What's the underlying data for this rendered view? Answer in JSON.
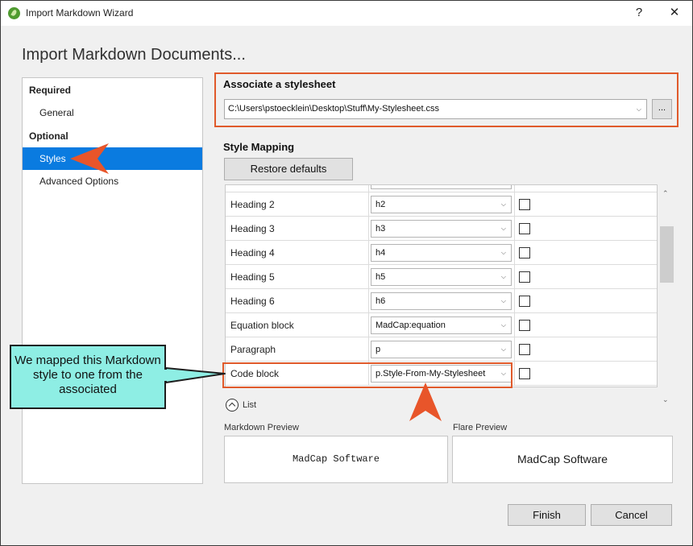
{
  "window": {
    "title": "Import Markdown Wizard",
    "help": "?",
    "close": "✕"
  },
  "heading": "Import Markdown Documents...",
  "nav": {
    "required": "Required",
    "general": "General",
    "optional": "Optional",
    "styles": "Styles",
    "advanced": "Advanced Options"
  },
  "stylesheet": {
    "label": "Associate a stylesheet",
    "path": "C:\\Users\\pstoecklein\\Desktop\\Stuff\\My-Stylesheet.css",
    "browse": "..."
  },
  "mapping": {
    "label": "Style Mapping",
    "restore": "Restore defaults",
    "rows": [
      {
        "name": "Heading 2",
        "style": "h2"
      },
      {
        "name": "Heading 3",
        "style": "h3"
      },
      {
        "name": "Heading 4",
        "style": "h4"
      },
      {
        "name": "Heading 5",
        "style": "h5"
      },
      {
        "name": "Heading 6",
        "style": "h6"
      },
      {
        "name": "Equation block",
        "style": "MadCap:equation"
      },
      {
        "name": "Paragraph",
        "style": "p"
      },
      {
        "name": "Code block",
        "style": "p.Style-From-My-Stylesheet"
      }
    ],
    "list_label": "List"
  },
  "preview": {
    "markdown_label": "Markdown Preview",
    "markdown_text": "MadCap Software",
    "flare_label": "Flare Preview",
    "flare_text": "MadCap Software"
  },
  "buttons": {
    "finish": "Finish",
    "cancel": "Cancel"
  },
  "callout": "We mapped this Markdown style to one from the associated",
  "colors": {
    "highlight": "#e05a2b",
    "callout": "#8eeee4",
    "selection": "#0a7be0"
  }
}
